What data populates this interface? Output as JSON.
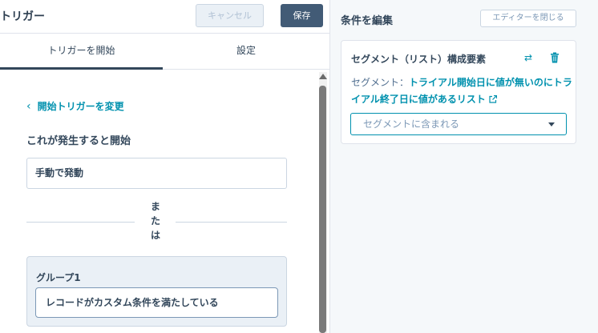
{
  "header": {
    "title": "トリガー",
    "cancel_label": "キャンセル",
    "save_label": "保存"
  },
  "tabs": [
    {
      "label": "トリガーを開始",
      "active": true
    },
    {
      "label": "設定",
      "active": false
    }
  ],
  "trigger": {
    "back_link": "開始トリガーを変更",
    "section_title": "これが発生すると開始",
    "manual_label": "手動で発動",
    "or_text": "または",
    "group_title": "グループ1",
    "group_item": "レコードがカスタム条件を満たしている"
  },
  "editor": {
    "title": "条件を編集",
    "close_label": "エディターを閉じる",
    "card_title": "セグメント（リスト）構成要素",
    "segment_prefix": "セグメント：",
    "segment_name": "トライアル開始日に値が無いのにトライアル終了日に値があるリスト",
    "select_value": "セグメントに含まれる"
  },
  "colors": {
    "accent": "#0091ae",
    "primary_button": "#425b76",
    "text": "#33475b"
  }
}
